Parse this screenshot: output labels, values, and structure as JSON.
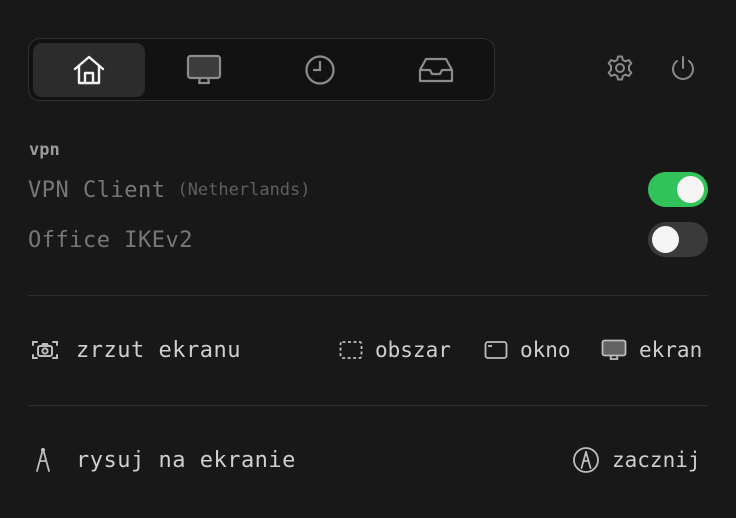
{
  "tabs": [
    {
      "id": "home",
      "icon": "home-icon",
      "active": true
    },
    {
      "id": "display",
      "icon": "monitor-icon",
      "active": false
    },
    {
      "id": "history",
      "icon": "clock-icon",
      "active": false
    },
    {
      "id": "inbox",
      "icon": "inbox-tray-icon",
      "active": false
    }
  ],
  "top_icons": [
    "gear-icon",
    "power-icon"
  ],
  "vpn": {
    "section_title": "vpn",
    "items": [
      {
        "name": "VPN Client",
        "location": "(Netherlands)",
        "enabled": true
      },
      {
        "name": "Office IKEv2",
        "location": "",
        "enabled": false
      }
    ]
  },
  "screenshot": {
    "icon": "camera-icon",
    "label": "zrzut ekranu",
    "options": [
      {
        "icon": "dashed-rect-icon",
        "label": "obszar"
      },
      {
        "icon": "window-icon",
        "label": "okno"
      },
      {
        "icon": "monitor-icon",
        "label": "ekran"
      }
    ]
  },
  "draw": {
    "icon": "pen-nib-icon",
    "label": "rysuj na ekranie",
    "start_icon": "pen-circle-icon",
    "start_label": "zacznij"
  },
  "colors": {
    "background": "#181818",
    "toggle_on": "#32c25a",
    "toggle_off": "#3a3a3a"
  }
}
